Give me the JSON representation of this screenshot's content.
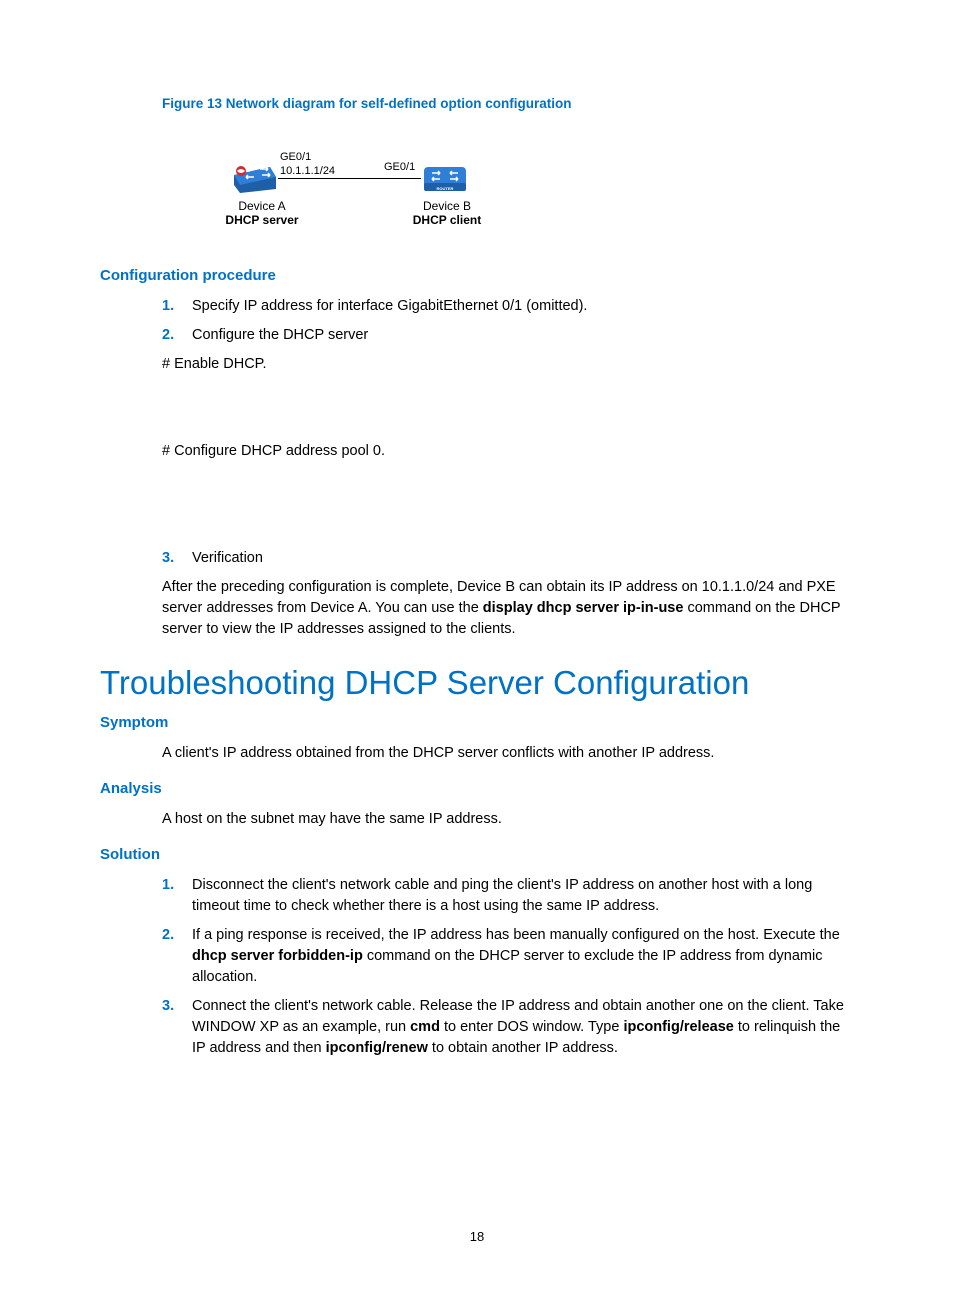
{
  "figure": {
    "caption": "Figure 13 Network diagram for self-defined option configuration",
    "ge01a": "GE0/1",
    "ip": "10.1.1.1/24",
    "ge01b": "GE0/1",
    "deviceA": "Device A",
    "roleA": "DHCP server",
    "deviceB": "Device B",
    "roleB": "DHCP client",
    "routerLabel": "ROUTER"
  },
  "config": {
    "heading": "Configuration procedure",
    "step1": "Specify IP address for interface GigabitEthernet 0/1 (omitted).",
    "step2": "Configure the DHCP server",
    "enable": "# Enable DHCP.",
    "pool": "# Configure DHCP address pool 0.",
    "step3": "Verification",
    "after_pre": "After the preceding configuration is complete, Device B can obtain its IP address on 10.1.1.0/24 and PXE server addresses from Device A. You can use the ",
    "after_bold": "display dhcp server ip-in-use",
    "after_post": " command on the DHCP server to view the IP addresses assigned to the clients."
  },
  "trouble": {
    "title": "Troubleshooting DHCP Server Configuration",
    "symptom_h": "Symptom",
    "symptom": "A client's IP address obtained from the DHCP server conflicts with another IP address.",
    "analysis_h": "Analysis",
    "analysis": "A host on the subnet may have the same IP address.",
    "solution_h": "Solution",
    "sol1": "Disconnect the client's network cable and ping the client's IP address on another host with a long timeout time to check whether there is a host using the same IP address.",
    "sol2_pre": "If a ping response is received, the IP address has been manually configured on the host. Execute the ",
    "sol2_bold": "dhcp server forbidden-ip",
    "sol2_post": " command on the DHCP server to exclude the IP address from dynamic allocation.",
    "sol3_pre": "Connect the client's network cable. Release the IP address and obtain another one on the client. Take WINDOW XP as an example, run ",
    "sol3_b1": "cmd",
    "sol3_mid1": " to enter DOS window. Type ",
    "sol3_b2": "ipconfig/release",
    "sol3_mid2": " to relinquish the IP address and then ",
    "sol3_b3": "ipconfig/renew",
    "sol3_post": " to obtain another IP address."
  },
  "pagenum": "18"
}
